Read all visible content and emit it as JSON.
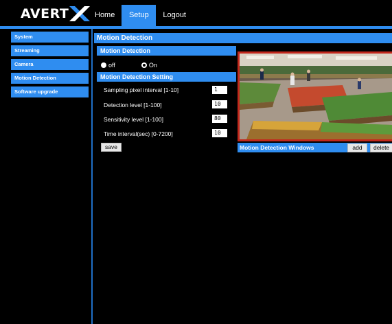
{
  "brand": {
    "logo_text": "AVERT",
    "accent": "#2f8df0"
  },
  "topnav": {
    "items": [
      {
        "label": "Home"
      },
      {
        "label": "Setup"
      },
      {
        "label": "Logout"
      }
    ],
    "active": "Setup"
  },
  "sidebar": {
    "items": [
      {
        "label": "System"
      },
      {
        "label": "Streaming"
      },
      {
        "label": "Camera"
      },
      {
        "label": "Motion Detection"
      },
      {
        "label": "Software upgrade"
      }
    ]
  },
  "page": {
    "title": "Motion Detection"
  },
  "motion": {
    "section_label": "Motion Detection",
    "off_label": "off",
    "on_label": "On",
    "selected": "On"
  },
  "settings": {
    "section_label": "Motion Detection Setting",
    "fields": [
      {
        "label": "Sampling pixel interval [1-10]",
        "value": "1"
      },
      {
        "label": "Detection level [1-100]",
        "value": "10"
      },
      {
        "label": "Sensitivity level [1-100]",
        "value": "80"
      },
      {
        "label": "Time interval(sec) [0-7200]",
        "value": "10"
      }
    ],
    "save_label": "save"
  },
  "windows": {
    "title": "Motion Detection Windows",
    "add_label": "add",
    "delete_label": "delete"
  }
}
